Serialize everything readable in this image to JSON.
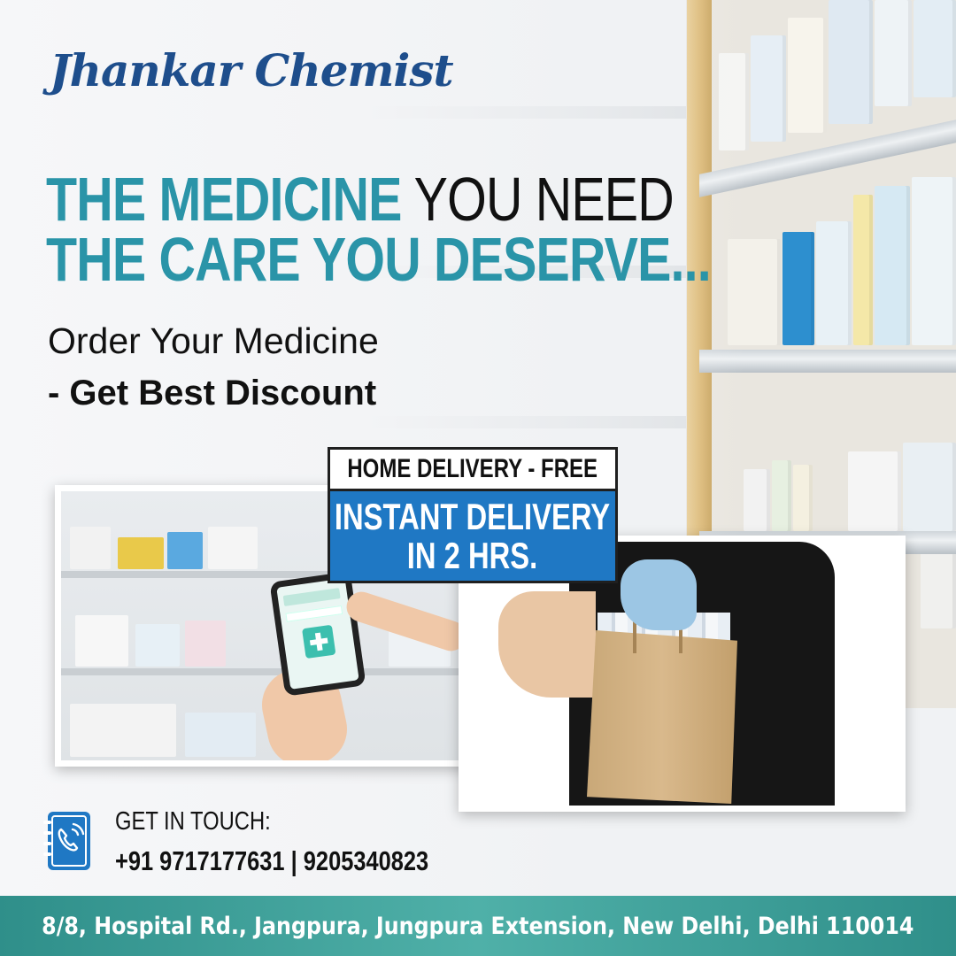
{
  "brand": {
    "name": "Jhankar Chemist"
  },
  "headline": {
    "line1_highlight": "THE MEDICINE",
    "line1_rest": " YOU NEED",
    "line2": "THE CARE YOU DESERVE..."
  },
  "subheading": {
    "line1": "Order Your Medicine",
    "line2": "- Get Best Discount"
  },
  "delivery": {
    "label_top": "HOME DELIVERY - FREE",
    "label_main_line1": "INSTANT DELIVERY",
    "label_main_line2": "IN 2 HRS."
  },
  "contact": {
    "title": "GET IN TOUCH:",
    "numbers": "+91 9717177631 | 9205340823",
    "icon": "phone-book-icon"
  },
  "footer": {
    "address": "8/8, Hospital Rd., Jangpura, Jungpura Extension, New Delhi, Delhi 110014"
  },
  "colors": {
    "brand": "#1e4e8c",
    "teal": "#2a94a8",
    "label_blue": "#1f78c4",
    "footer": "#3fa29b"
  }
}
